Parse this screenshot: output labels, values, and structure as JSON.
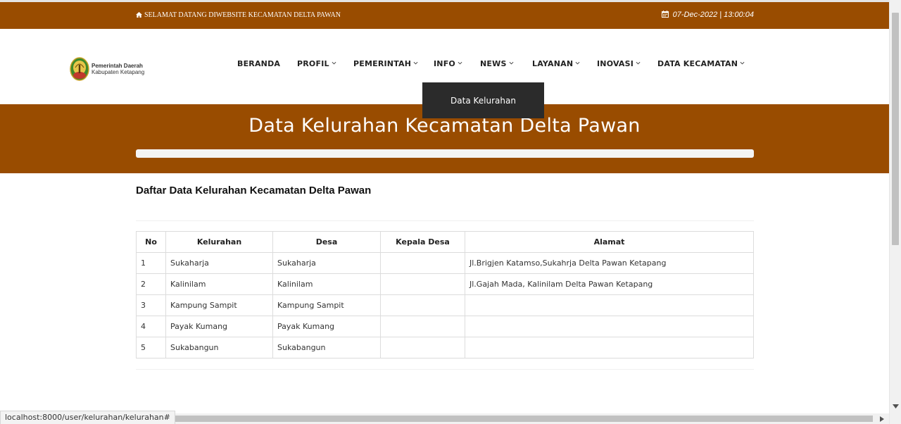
{
  "topbar": {
    "welcome_text": "SELAMAT DATANG DIWEBSITE KECAMATAN DELTA PAWAN",
    "datetime_text": "07-Dec-2022 | 13:00:04"
  },
  "logo": {
    "line1": "Pemerintah Daerah",
    "line2": "Kabupaten Ketapang"
  },
  "nav": {
    "items": [
      {
        "label": "BERANDA",
        "has_dropdown": false
      },
      {
        "label": "PROFIL",
        "has_dropdown": true
      },
      {
        "label": "PEMERINTAH",
        "has_dropdown": true
      },
      {
        "label": "INFO",
        "has_dropdown": true
      },
      {
        "label": "NEWS",
        "has_dropdown": true
      },
      {
        "label": "LAYANAN",
        "has_dropdown": true
      },
      {
        "label": "INOVASI",
        "has_dropdown": true
      },
      {
        "label": "DATA KECAMATAN",
        "has_dropdown": true
      }
    ],
    "open_dropdown": {
      "items": [
        {
          "label": "Data Kelurahan"
        }
      ]
    }
  },
  "banner": {
    "title": "Data Kelurahan Kecamatan Delta Pawan"
  },
  "content": {
    "section_title": "Daftar Data Kelurahan Kecamatan Delta Pawan",
    "table": {
      "headers": [
        "No",
        "Kelurahan",
        "Desa",
        "Kepala Desa",
        "Alamat"
      ],
      "rows": [
        [
          "1",
          "Sukaharja",
          "Sukaharja",
          "",
          "Jl.Brigjen Katamso,Sukahrja Delta Pawan Ketapang"
        ],
        [
          "2",
          "Kalinilam",
          "Kalinilam",
          "",
          "Jl.Gajah Mada, Kalinilam Delta Pawan Ketapang"
        ],
        [
          "3",
          "Kampung Sampit",
          "Kampung Sampit",
          "",
          ""
        ],
        [
          "4",
          "Payak Kumang",
          "Payak Kumang",
          "",
          ""
        ],
        [
          "5",
          "Sukabangun",
          "Sukabangun",
          "",
          ""
        ]
      ]
    }
  },
  "browser": {
    "status_url": "localhost:8000/user/kelurahan/kelurahan#"
  },
  "colors": {
    "brand_brown": "#994c00",
    "dropdown_bg": "#2b2b2b"
  },
  "icons": {
    "welcome": "home-icon",
    "datetime": "calendar-icon",
    "nav_dropdown": "chevron-down-icon"
  }
}
